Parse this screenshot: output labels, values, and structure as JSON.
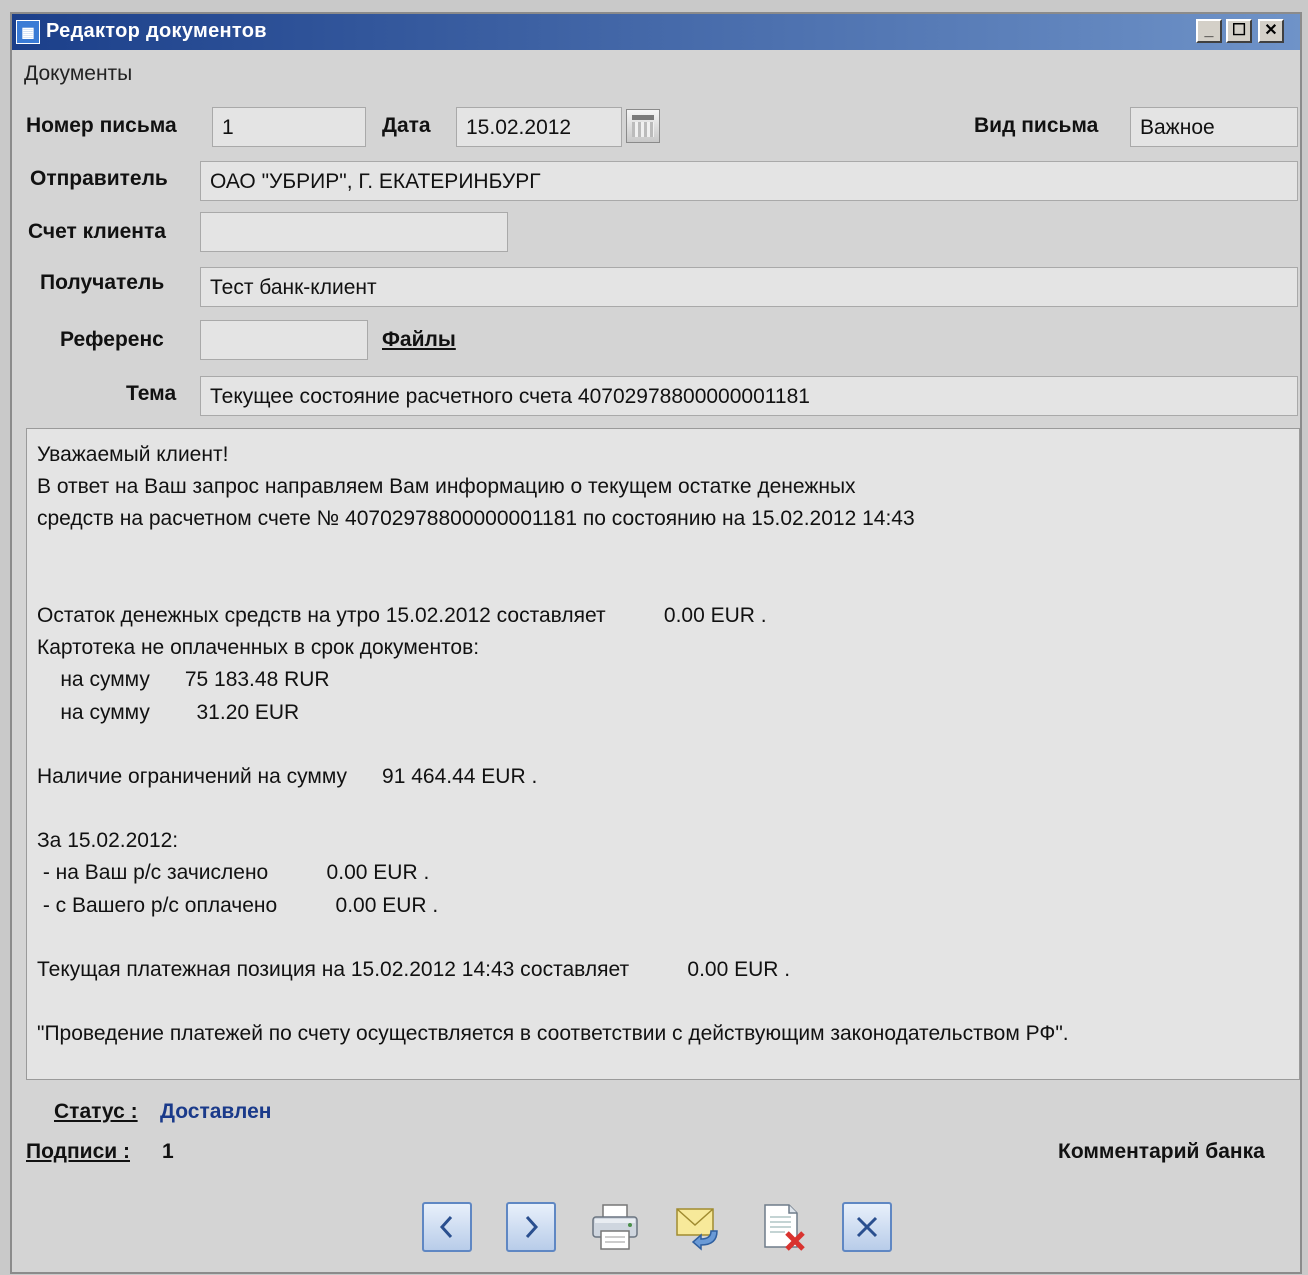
{
  "window": {
    "title": "Редактор документов",
    "app_icon": "document-editor-icon"
  },
  "menu": {
    "documents": "Документы"
  },
  "form": {
    "letter_number_label": "Номер письма",
    "letter_number_value": "1",
    "date_label": "Дата",
    "date_value": "15.02.2012",
    "letter_type_label": "Вид письма",
    "letter_type_value": "Важное",
    "sender_label": "Отправитель",
    "sender_value": "ОАО \"УБРИР\", Г. ЕКАТЕРИНБУРГ",
    "client_account_label": "Счет клиента",
    "client_account_value": "",
    "recipient_label": "Получатель",
    "recipient_value": "Тест банк-клиент",
    "reference_label": "Референс",
    "reference_value": "",
    "files_link": "Файлы",
    "subject_label": "Тема",
    "subject_value": "Текущее состояние расчетного счета 40702978800000001181"
  },
  "body_lines": [
    "Уважаемый клиент!",
    "В ответ на Ваш запрос направляем Вам информацию о текущем остатке денежных",
    "средств на расчетном счете № 40702978800000001181 по состоянию на 15.02.2012 14:43",
    "",
    "",
    "Остаток денежных средств на утро 15.02.2012 составляет          0.00 EUR .",
    "Картотека не оплаченных в срок документов:",
    "    на сумму      75 183.48 RUR",
    "    на сумму        31.20 EUR",
    "",
    "Наличие ограничений на сумму      91 464.44 EUR .",
    "",
    "За 15.02.2012:",
    " - на Ваш р/с зачислено          0.00 EUR .",
    " - с Вашего р/с оплачено          0.00 EUR .",
    "",
    "Текущая платежная позиция на 15.02.2012 14:43 составляет          0.00 EUR .",
    "",
    "\"Проведение платежей по счету осуществляется в соответствии с действующим законодательством РФ\"."
  ],
  "status": {
    "status_label": "Статус :",
    "status_value": "Доставлен",
    "signatures_label": "Подписи :",
    "signatures_value": "1",
    "bank_comment_label": "Комментарий банка"
  },
  "toolbar": [
    {
      "icon": "arrow-left-icon"
    },
    {
      "icon": "arrow-right-icon"
    },
    {
      "icon": "printer-icon"
    },
    {
      "icon": "envelope-reply-icon"
    },
    {
      "icon": "document-delete-icon"
    },
    {
      "icon": "close-icon"
    }
  ],
  "colors": {
    "titlebar_start": "#1b3f8a",
    "titlebar_end": "#6f93c8",
    "status_value": "#1a3a8a",
    "window_bg": "#d4d4d4"
  }
}
